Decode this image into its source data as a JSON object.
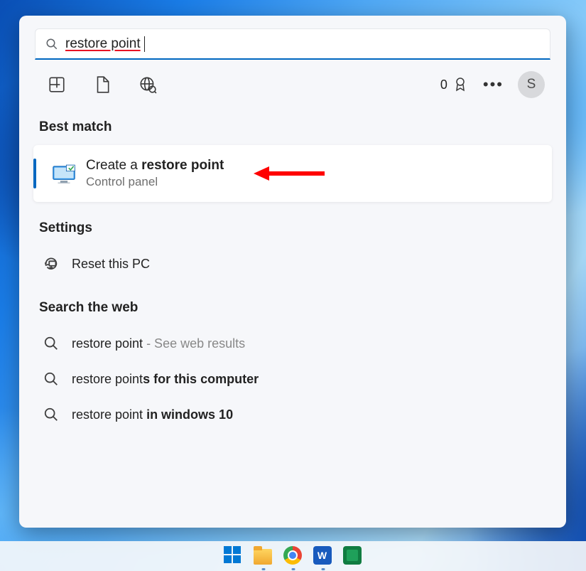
{
  "search": {
    "query": "restore point"
  },
  "rewards": {
    "points": "0"
  },
  "avatar": {
    "initial": "S"
  },
  "sections": {
    "best_match": "Best match",
    "settings": "Settings",
    "web": "Search the web"
  },
  "best_match_item": {
    "title_pre": "Create a ",
    "title_bold": "restore point",
    "subtitle": "Control panel"
  },
  "settings_items": [
    {
      "label": "Reset this PC"
    }
  ],
  "web_items": [
    {
      "pre": "restore point",
      "bold": "",
      "suffix": " - See web results"
    },
    {
      "pre": "restore point",
      "bold": "s for this computer",
      "suffix": ""
    },
    {
      "pre": "restore point ",
      "bold": "in windows 10",
      "suffix": ""
    }
  ],
  "taskbar_apps": [
    {
      "name": "start"
    },
    {
      "name": "file-explorer"
    },
    {
      "name": "chrome"
    },
    {
      "name": "word"
    },
    {
      "name": "app-green"
    }
  ]
}
